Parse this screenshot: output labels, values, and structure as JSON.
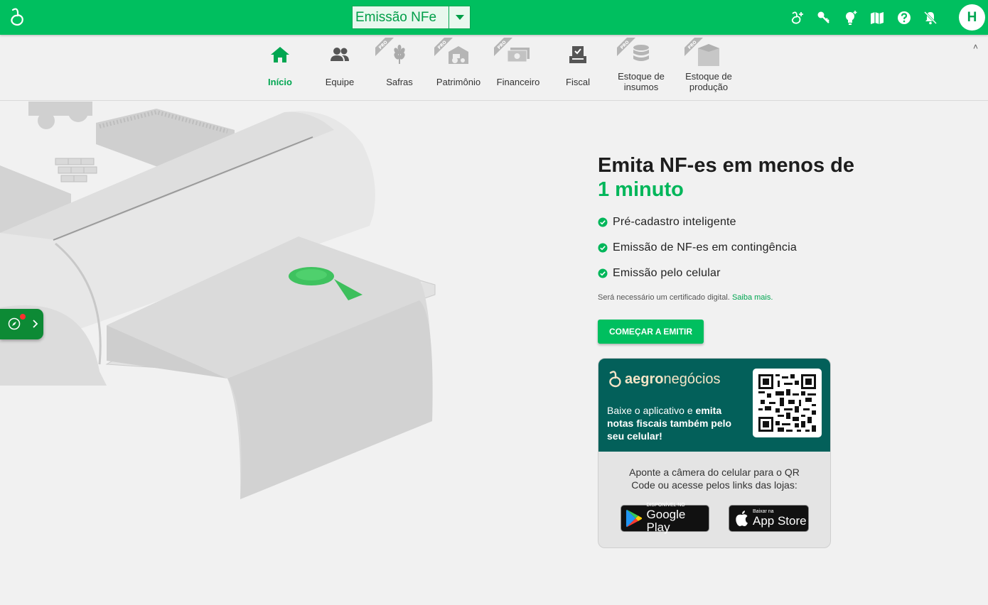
{
  "topbar": {
    "module_label": "Emissão NFe",
    "icons": [
      "add-user-icon",
      "key-icon",
      "lightbulb-icon",
      "book-map-icon",
      "help-icon",
      "notifications-off-icon"
    ],
    "avatar_initial": "H",
    "brand_color": "#00bf5f"
  },
  "modules": [
    {
      "label": "Início",
      "icon": "home-icon",
      "active": true,
      "pro": false
    },
    {
      "label": "Equipe",
      "icon": "team-icon",
      "active": false,
      "pro": false
    },
    {
      "label": "Safras",
      "icon": "wheat-icon",
      "active": false,
      "pro": true
    },
    {
      "label": "Patrimônio",
      "icon": "tractor-barn-icon",
      "active": false,
      "pro": true
    },
    {
      "label": "Financeiro",
      "icon": "money-icon",
      "active": false,
      "pro": true
    },
    {
      "label": "Fiscal",
      "icon": "invoice-machine-icon",
      "active": false,
      "pro": false
    },
    {
      "label_line1": "Estoque de",
      "label_line2": "insumos",
      "icon": "database-icon",
      "active": false,
      "pro": true
    },
    {
      "label_line1": "Estoque de",
      "label_line2": "produção",
      "icon": "silo-icon",
      "active": false,
      "pro": true
    }
  ],
  "pro_badge": "PRO",
  "main": {
    "headline_line1": "Emita NF-es em menos de",
    "headline_line2": "1 minuto",
    "features": [
      "Pré-cadastro inteligente",
      "Emissão de NF-es em contingência",
      "Emissão pelo celular"
    ],
    "note": "Será necessário um certificado digital.",
    "note_link": "Saiba mais.",
    "cta": "COMEÇAR A EMITIR"
  },
  "app_card": {
    "brand_bold": "aegro",
    "brand_light": "negócios",
    "text_plain": "Baixe o aplicativo e ",
    "text_bold": "emita notas fiscais também pelo seu celular!",
    "instructions": "Aponte a câmera do celular para o QR Code ou acesse pelos links das lojas:",
    "google_small": "DISPONÍVEL NO",
    "google_big": "Google Play",
    "apple_small": "Baixar na",
    "apple_big": "App Store",
    "bg_color": "#03605a"
  }
}
